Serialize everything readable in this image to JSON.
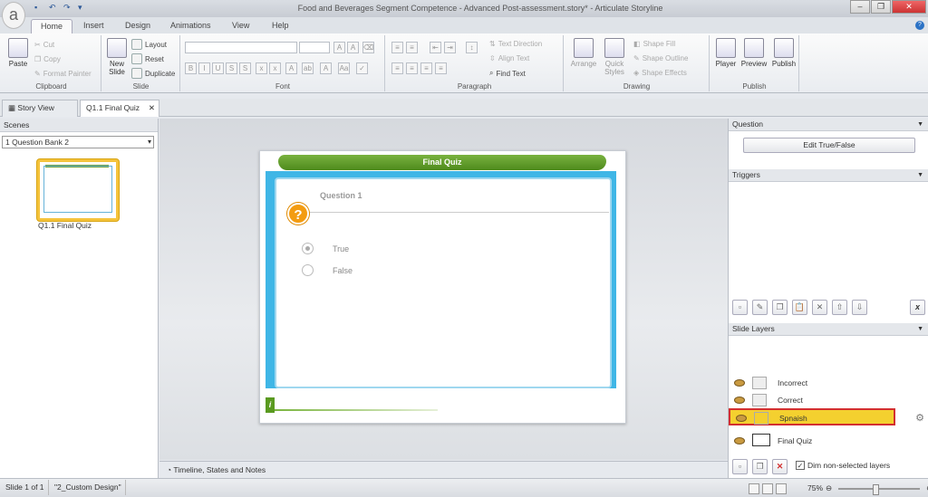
{
  "window": {
    "title": "Food and Beverages Segment Competence - Advanced Post-assessment.story* - Articulate Storyline"
  },
  "ribbon_tabs": [
    "Home",
    "Insert",
    "Design",
    "Animations",
    "View",
    "Help"
  ],
  "ribbon": {
    "clipboard": {
      "paste": "Paste",
      "cut": "Cut",
      "copy": "Copy",
      "format_painter": "Format Painter",
      "label": "Clipboard"
    },
    "slide": {
      "new_slide": "New Slide",
      "layout": "Layout",
      "reset": "Reset",
      "duplicate": "Duplicate",
      "label": "Slide"
    },
    "font": {
      "label": "Font"
    },
    "paragraph": {
      "text_direction": "Text Direction",
      "align_text": "Align Text",
      "find_text": "Find Text",
      "label": "Paragraph"
    },
    "drawing": {
      "arrange": "Arrange",
      "quick_styles": "Quick Styles",
      "shape_fill": "Shape Fill",
      "shape_outline": "Shape Outline",
      "shape_effects": "Shape Effects",
      "label": "Drawing"
    },
    "publish": {
      "player": "Player",
      "preview": "Preview",
      "publish": "Publish",
      "label": "Publish"
    }
  },
  "doc_tabs": {
    "story_view": "Story View",
    "current": "Q1.1 Final Quiz"
  },
  "left_panel": {
    "header": "Scenes",
    "scene_select": "1 Question Bank 2",
    "thumb_label": "Q1.1 Final Quiz"
  },
  "slide": {
    "banner": "Final Quiz",
    "question": "Question 1",
    "icon": "?",
    "options": [
      "True",
      "False"
    ],
    "info_icon": "i"
  },
  "timeline": {
    "label": "Timeline, States and Notes"
  },
  "right_panel": {
    "question_header": "Question",
    "edit_button": "Edit True/False",
    "triggers_header": "Triggers",
    "layers_header": "Slide Layers",
    "layers": [
      "Incorrect",
      "Correct",
      "Spnaish"
    ],
    "base_layer": "Final Quiz",
    "dim_label": "Dim non-selected layers"
  },
  "status": {
    "slide": "Slide 1 of 1",
    "design": "\"2_Custom Design\"",
    "zoom": "75%"
  },
  "colors": {
    "accent_green": "#5a9a20",
    "question_orange": "#f39c12",
    "selected_layer": "#f4d02f",
    "highlight_red": "#d32f2f"
  }
}
